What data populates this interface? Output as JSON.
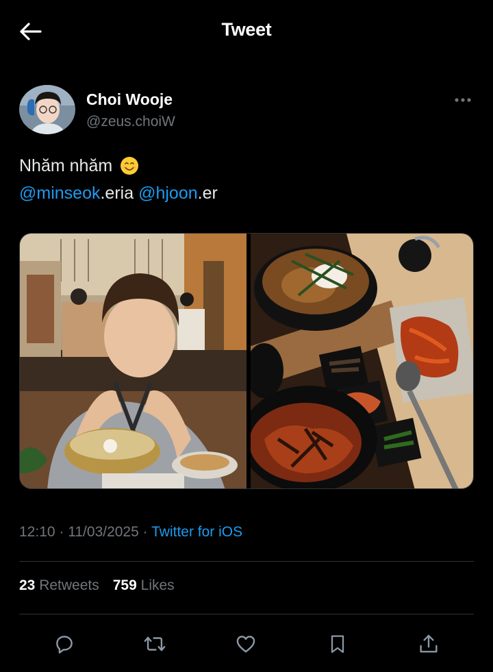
{
  "header": {
    "back_icon": "arrow-left-icon",
    "title": "Tweet"
  },
  "author": {
    "display_name": "Choi Wooje",
    "handle": "@zeus.choiW",
    "more_icon": "more-horizontal-icon"
  },
  "tweet": {
    "line1_text": "Nhăm nhăm",
    "line1_emoji": "smiling-face-emoji",
    "mention1": "@minseok",
    "mention1_suffix": ".eria",
    "mention2": "@hjoon",
    "mention2_suffix": ".er"
  },
  "media": [
    {
      "name": "photo-person-with-scissors"
    },
    {
      "name": "photo-korean-food-table"
    }
  ],
  "meta": {
    "time": "12:10",
    "separator": "·",
    "date": "11/03/2025",
    "source": "Twitter for iOS"
  },
  "stats": {
    "retweets_count": "23",
    "retweets_label": "Retweets",
    "likes_count": "759",
    "likes_label": "Likes"
  },
  "actions": [
    "reply-icon",
    "retweet-icon",
    "like-icon",
    "bookmark-icon",
    "share-icon"
  ],
  "colors": {
    "background": "#000000",
    "link": "#1d9bf0",
    "secondary_text": "#71767b",
    "divider": "#2f3336"
  }
}
